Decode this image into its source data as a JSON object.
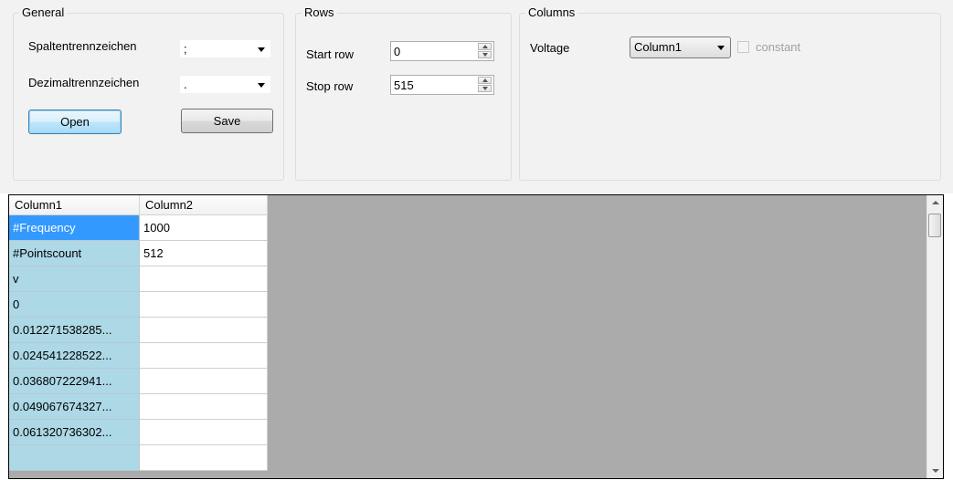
{
  "general": {
    "title": "General",
    "column_separator_label": "Spaltentrennzeichen",
    "column_separator_value": ";",
    "decimal_separator_label": "Dezimaltrennzeichen",
    "decimal_separator_value": ".",
    "open_label": "Open",
    "save_label": "Save"
  },
  "rows": {
    "title": "Rows",
    "start_label": "Start row",
    "start_value": "0",
    "stop_label": "Stop row",
    "stop_value": "515"
  },
  "columns": {
    "title": "Columns",
    "voltage_label": "Voltage",
    "voltage_value": "Column1",
    "constant_label": "constant"
  },
  "grid": {
    "headers": [
      "Column1",
      "Column2"
    ],
    "rows": [
      [
        "#Frequency",
        "1000"
      ],
      [
        "#Pointscount",
        "512"
      ],
      [
        "v",
        ""
      ],
      [
        "0",
        ""
      ],
      [
        "0.012271538285...",
        ""
      ],
      [
        "0.024541228522...",
        ""
      ],
      [
        "0.036807222941...",
        ""
      ],
      [
        "0.049067674327...",
        ""
      ],
      [
        "0.061320736302...",
        ""
      ]
    ]
  }
}
